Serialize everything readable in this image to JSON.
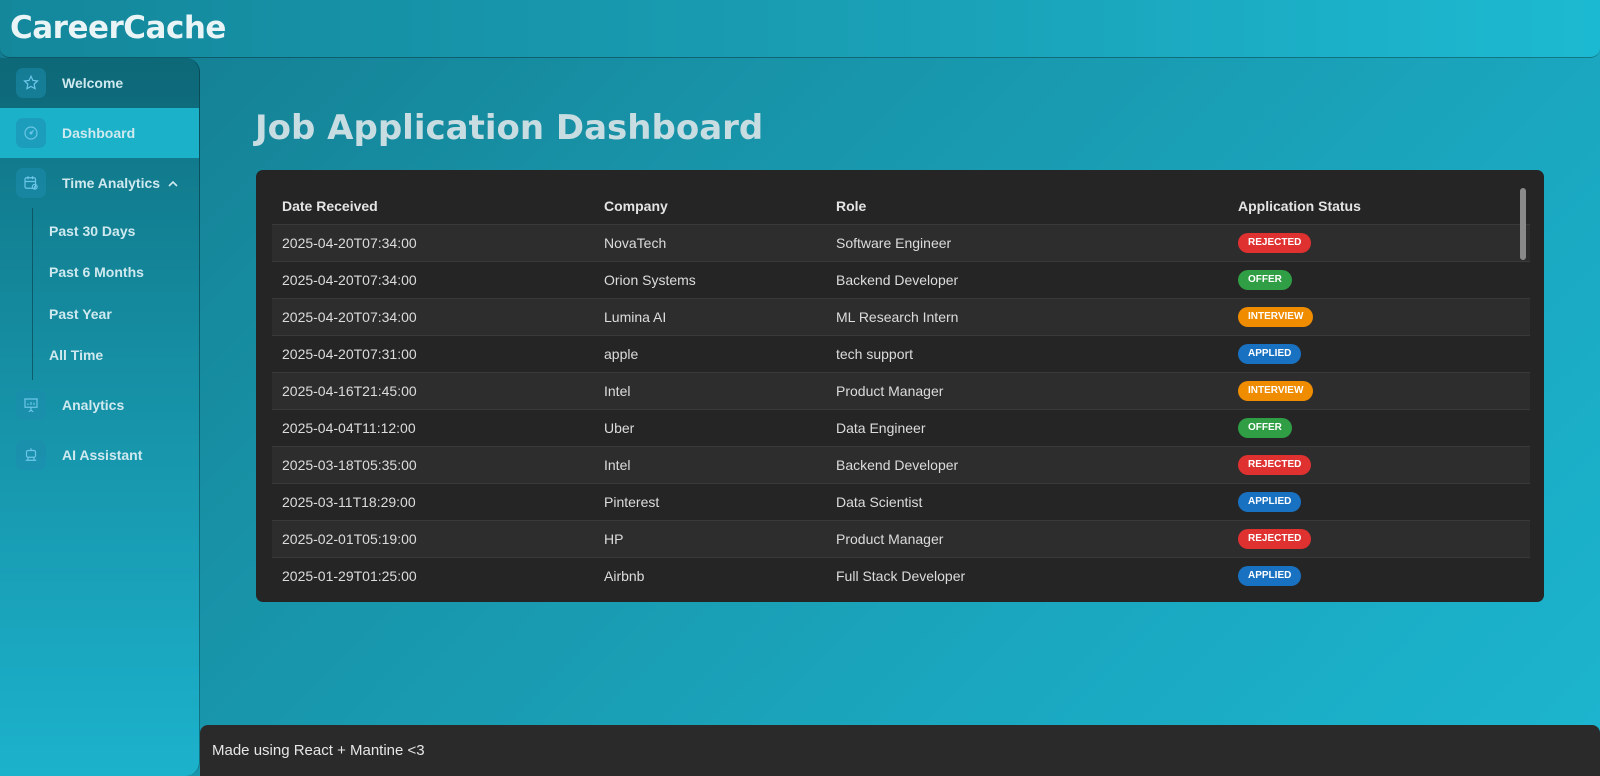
{
  "app": {
    "title": "CareerCache"
  },
  "sidebar": {
    "items": [
      {
        "label": "Welcome",
        "icon": "star-icon"
      },
      {
        "label": "Dashboard",
        "icon": "gauge-icon"
      },
      {
        "label": "Time Analytics",
        "icon": "calendar-clock-icon"
      },
      {
        "label": "Analytics",
        "icon": "presentation-chart-icon"
      },
      {
        "label": "AI Assistant",
        "icon": "robot-icon"
      }
    ],
    "sub_items": [
      {
        "label": "Past 30 Days"
      },
      {
        "label": "Past 6 Months"
      },
      {
        "label": "Past Year"
      },
      {
        "label": "All Time"
      }
    ]
  },
  "main": {
    "title": "Job Application Dashboard"
  },
  "table": {
    "headers": [
      "Date Received",
      "Company",
      "Role",
      "Application Status"
    ],
    "rows": [
      {
        "date": "2025-04-20T07:34:00",
        "company": "NovaTech",
        "role": "Software Engineer",
        "status": "REJECTED"
      },
      {
        "date": "2025-04-20T07:34:00",
        "company": "Orion Systems",
        "role": "Backend Developer",
        "status": "OFFER"
      },
      {
        "date": "2025-04-20T07:34:00",
        "company": "Lumina AI",
        "role": "ML Research Intern",
        "status": "INTERVIEW"
      },
      {
        "date": "2025-04-20T07:31:00",
        "company": "apple",
        "role": "tech support",
        "status": "APPLIED"
      },
      {
        "date": "2025-04-16T21:45:00",
        "company": "Intel",
        "role": "Product Manager",
        "status": "INTERVIEW"
      },
      {
        "date": "2025-04-04T11:12:00",
        "company": "Uber",
        "role": "Data Engineer",
        "status": "OFFER"
      },
      {
        "date": "2025-03-18T05:35:00",
        "company": "Intel",
        "role": "Backend Developer",
        "status": "REJECTED"
      },
      {
        "date": "2025-03-11T18:29:00",
        "company": "Pinterest",
        "role": "Data Scientist",
        "status": "APPLIED"
      },
      {
        "date": "2025-02-01T05:19:00",
        "company": "HP",
        "role": "Product Manager",
        "status": "REJECTED"
      },
      {
        "date": "2025-01-29T01:25:00",
        "company": "Airbnb",
        "role": "Full Stack Developer",
        "status": "APPLIED"
      }
    ]
  },
  "status_colors": {
    "REJECTED": "#e03131",
    "OFFER": "#2f9e44",
    "INTERVIEW": "#f08c00",
    "APPLIED": "#1971c2"
  },
  "footer": {
    "text": "Made using React + Mantine <3"
  }
}
